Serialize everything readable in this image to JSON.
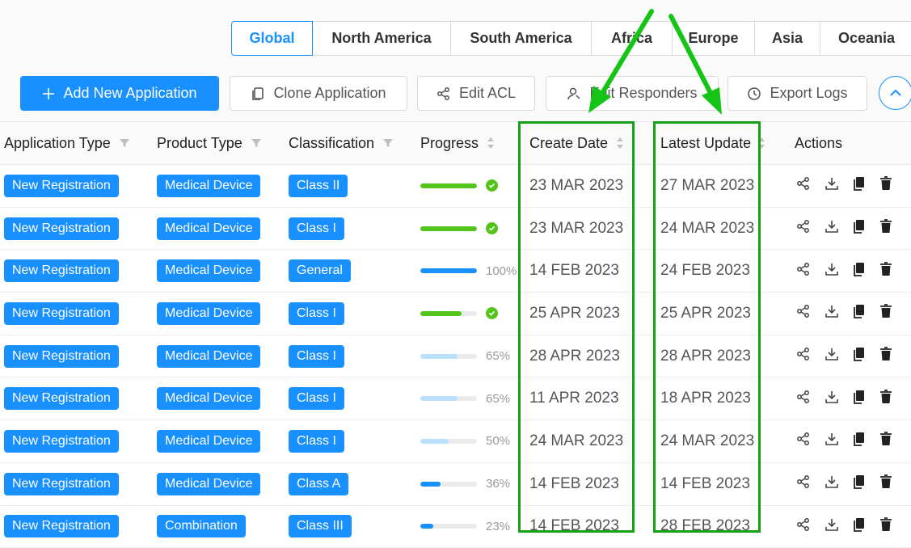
{
  "region_tabs": [
    {
      "label": "Global",
      "active": true
    },
    {
      "label": "North America",
      "active": false
    },
    {
      "label": "South America",
      "active": false
    },
    {
      "label": "Africa",
      "active": false
    },
    {
      "label": "Europe",
      "active": false
    },
    {
      "label": "Asia",
      "active": false
    },
    {
      "label": "Oceania",
      "active": false
    }
  ],
  "toolbar": {
    "add_label": "Add New Application",
    "clone_label": "Clone Application",
    "acl_label": "Edit ACL",
    "responders_label": "Edit Responders",
    "export_label": "Export Logs"
  },
  "table": {
    "columns": {
      "app_type": "Application Type",
      "product_type": "Product Type",
      "classification": "Classification",
      "progress": "Progress",
      "create_date": "Create Date",
      "latest_update": "Latest Update",
      "actions": "Actions"
    },
    "rows": [
      {
        "app_type": "New Registration",
        "product_type": "Medical Device",
        "classification": "Class II",
        "progress": 100,
        "status": "done",
        "progress_text": "",
        "create_date": "23 MAR 2023",
        "latest_update": "27 MAR 2023"
      },
      {
        "app_type": "New Registration",
        "product_type": "Medical Device",
        "classification": "Class I",
        "progress": 100,
        "status": "done",
        "progress_text": "",
        "create_date": "23 MAR 2023",
        "latest_update": "24 MAR 2023"
      },
      {
        "app_type": "New Registration",
        "product_type": "Medical Device",
        "classification": "General",
        "progress": 100,
        "status": "active",
        "progress_text": "100%",
        "create_date": "14 FEB 2023",
        "latest_update": "24 FEB 2023"
      },
      {
        "app_type": "New Registration",
        "product_type": "Medical Device",
        "classification": "Class I",
        "progress": 73,
        "status": "done",
        "progress_text": "",
        "create_date": "25 APR 2023",
        "latest_update": "25 APR 2023"
      },
      {
        "app_type": "New Registration",
        "product_type": "Medical Device",
        "classification": "Class I",
        "progress": 65,
        "status": "light",
        "progress_text": "65%",
        "create_date": "28 APR 2023",
        "latest_update": "28 APR 2023"
      },
      {
        "app_type": "New Registration",
        "product_type": "Medical Device",
        "classification": "Class I",
        "progress": 65,
        "status": "light",
        "progress_text": "65%",
        "create_date": "11 APR 2023",
        "latest_update": "18 APR 2023"
      },
      {
        "app_type": "New Registration",
        "product_type": "Medical Device",
        "classification": "Class I",
        "progress": 50,
        "status": "light",
        "progress_text": "50%",
        "create_date": "24 MAR 2023",
        "latest_update": "24 MAR 2023"
      },
      {
        "app_type": "New Registration",
        "product_type": "Medical Device",
        "classification": "Class A",
        "progress": 36,
        "status": "active",
        "progress_text": "36%",
        "create_date": "14 FEB 2023",
        "latest_update": "14 FEB 2023"
      },
      {
        "app_type": "New Registration",
        "product_type": "Combination",
        "classification": "Class III",
        "progress": 23,
        "status": "active",
        "progress_text": "23%",
        "create_date": "14 FEB 2023",
        "latest_update": "28 FEB 2023"
      }
    ]
  },
  "colors": {
    "primary": "#1890ff",
    "success": "#52c41a",
    "light_progress": "#bae0fb",
    "annotation": "#15a015"
  }
}
